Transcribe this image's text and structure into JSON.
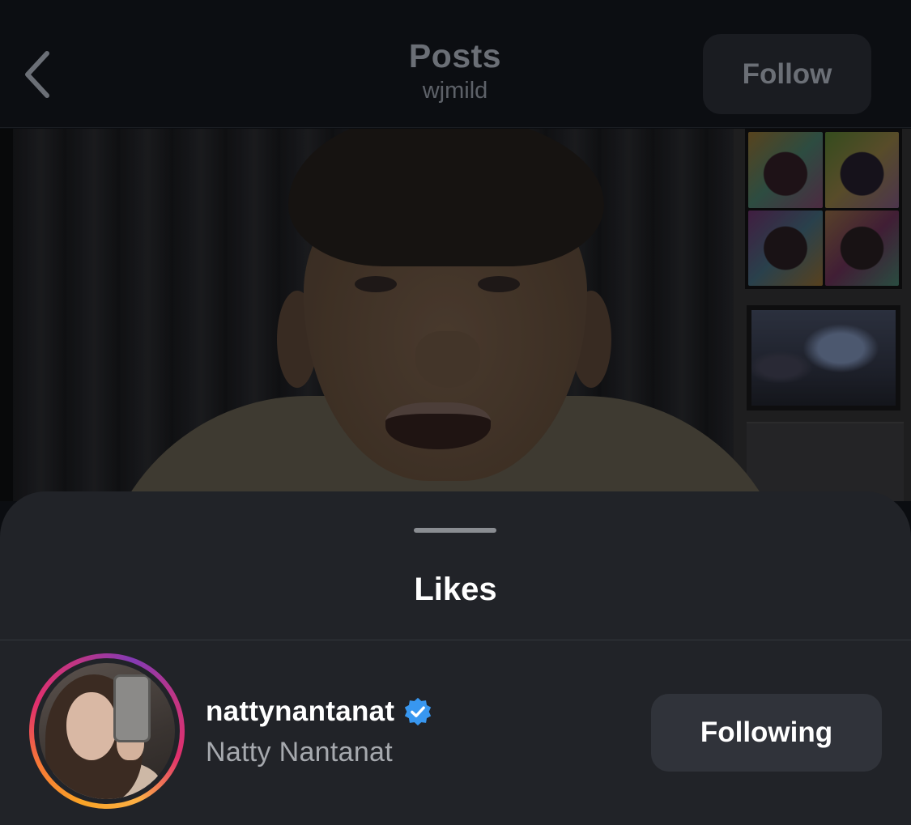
{
  "nav": {
    "title": "Posts",
    "subtitle": "wjmild",
    "follow_label": "Follow",
    "back_icon": "chevron-left-icon"
  },
  "sheet": {
    "title": "Likes"
  },
  "likes": [
    {
      "username": "nattynantanat",
      "full_name": "Natty Nantanat",
      "verified": true,
      "has_story_ring": true,
      "button_label": "Following"
    }
  ],
  "colors": {
    "background": "#0b0d11",
    "sheet": "#212328",
    "verified_badge": "#3897f0",
    "button": "#30333a"
  }
}
